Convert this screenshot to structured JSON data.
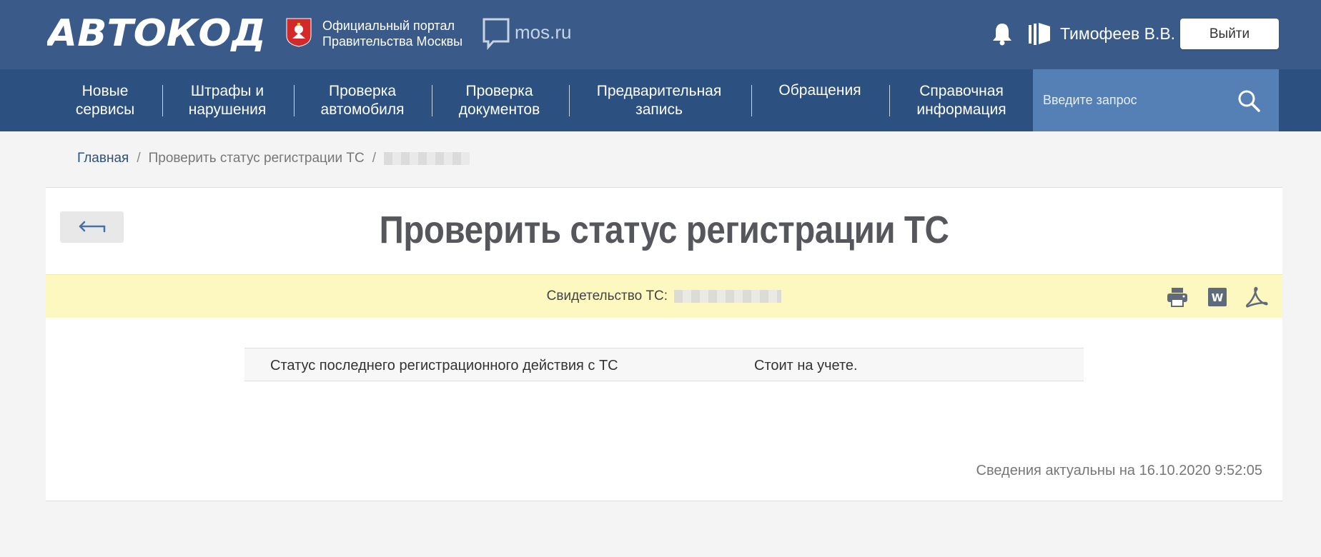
{
  "header": {
    "logo_text": "АВТОКОД",
    "portal_line1": "Официальный портал",
    "portal_line2": "Правительства Москвы",
    "mosru": "mos.ru",
    "user_name": "Тимофеев В.В.",
    "logout_label": "Выйти"
  },
  "nav": {
    "items": [
      {
        "line1": "Новые",
        "line2": "сервисы"
      },
      {
        "line1": "Штрафы и",
        "line2": "нарушения"
      },
      {
        "line1": "Проверка",
        "line2": "автомобиля"
      },
      {
        "line1": "Проверка",
        "line2": "документов"
      },
      {
        "line1": "Предварительная",
        "line2": "запись"
      },
      {
        "line1": "Обращения",
        "line2": ""
      },
      {
        "line1": "Справочная",
        "line2": "информация"
      }
    ],
    "search_placeholder": "Введите запрос"
  },
  "breadcrumb": {
    "home": "Главная",
    "current": "Проверить статус регистрации ТС"
  },
  "page": {
    "title": "Проверить статус регистрации ТС",
    "cert_label": "Свидетельство ТС:",
    "row_label": "Статус последнего регистрационного действия с ТС",
    "row_value": "Стоит на учете.",
    "updated": "Сведения актуальны на 16.10.2020 9:52:05"
  },
  "colors": {
    "header_bg": "#3a5a8a",
    "nav_bg": "#2c5180",
    "search_bg": "#5580b5",
    "cert_bar_bg": "#fdf7c0"
  }
}
